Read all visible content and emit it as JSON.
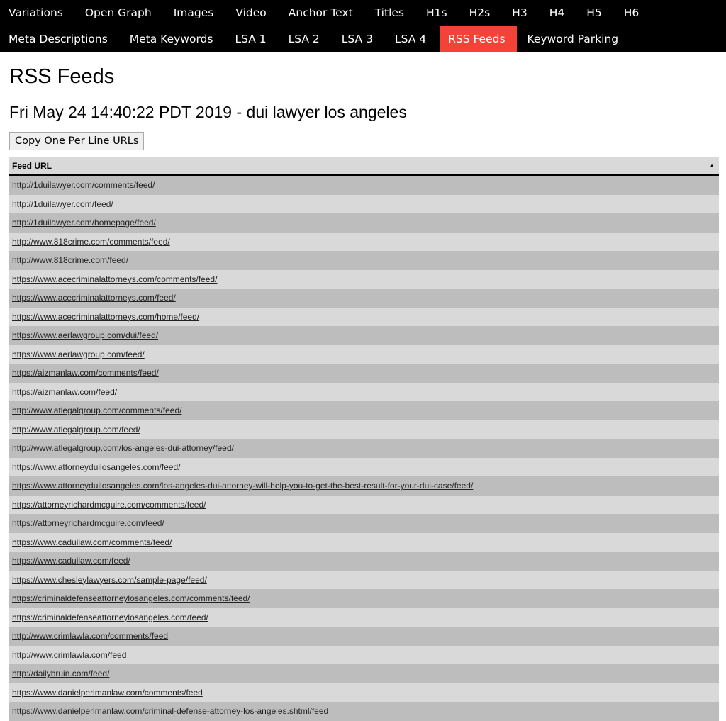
{
  "nav": {
    "row1": [
      {
        "label": "Variations"
      },
      {
        "label": "Open Graph"
      },
      {
        "label": "Images"
      },
      {
        "label": "Video"
      },
      {
        "label": "Anchor Text"
      },
      {
        "label": "Titles"
      },
      {
        "label": "H1s"
      },
      {
        "label": "H2s"
      },
      {
        "label": "H3"
      },
      {
        "label": "H4"
      },
      {
        "label": "H5"
      },
      {
        "label": "H6"
      }
    ],
    "row2": [
      {
        "label": "Meta Descriptions"
      },
      {
        "label": "Meta Keywords"
      },
      {
        "label": "LSA 1"
      },
      {
        "label": "LSA 2"
      },
      {
        "label": "LSA 3"
      },
      {
        "label": "LSA 4"
      },
      {
        "label": "RSS Feeds",
        "active": true
      },
      {
        "label": "Keyword Parking"
      }
    ],
    "active_color": "#f44336"
  },
  "page": {
    "title": "RSS Feeds",
    "subtitle": "Fri May 24 14:40:22 PDT 2019 - dui lawyer los angeles",
    "copy_button_label": "Copy One Per Line URLs"
  },
  "table": {
    "column_header": "Feed URL",
    "sort_indicator": "▲",
    "rows": [
      "http://1duilawyer.com/comments/feed/",
      "http://1duilawyer.com/feed/",
      "http://1duilawyer.com/homepage/feed/",
      "http://www.818crime.com/comments/feed/",
      "http://www.818crime.com/feed/",
      "https://www.acecriminalattorneys.com/comments/feed/",
      "https://www.acecriminalattorneys.com/feed/",
      "https://www.acecriminalattorneys.com/home/feed/",
      "https://www.aerlawgroup.com/dui/feed/",
      "https://www.aerlawgroup.com/feed/",
      "https://aizmanlaw.com/comments/feed/",
      "https://aizmanlaw.com/feed/",
      "http://www.atlegalgroup.com/comments/feed/",
      "http://www.atlegalgroup.com/feed/",
      "http://www.atlegalgroup.com/los-angeles-dui-attorney/feed/",
      "https://www.attorneyduilosangeles.com/feed/",
      "https://www.attorneyduilosangeles.com/los-angeles-dui-attorney-will-help-you-to-get-the-best-result-for-your-dui-case/feed/",
      "https://attorneyrichardmcguire.com/comments/feed/",
      "https://attorneyrichardmcguire.com/feed/",
      "https://www.caduilaw.com/comments/feed/",
      "https://www.caduilaw.com/feed/",
      "https://www.chesleylawyers.com/sample-page/feed/",
      "https://criminaldefenseattorneylosangeles.com/comments/feed/",
      "https://criminaldefenseattorneylosangeles.com/feed/",
      "http://www.crimlawla.com/comments/feed",
      "http://www.crimlawla.com/feed",
      "http://dailybruin.com/feed/",
      "https://www.danielperlmanlaw.com/comments/feed",
      "https://www.danielperlmanlaw.com/criminal-defense-attorney-los-angeles.shtml/feed"
    ]
  }
}
